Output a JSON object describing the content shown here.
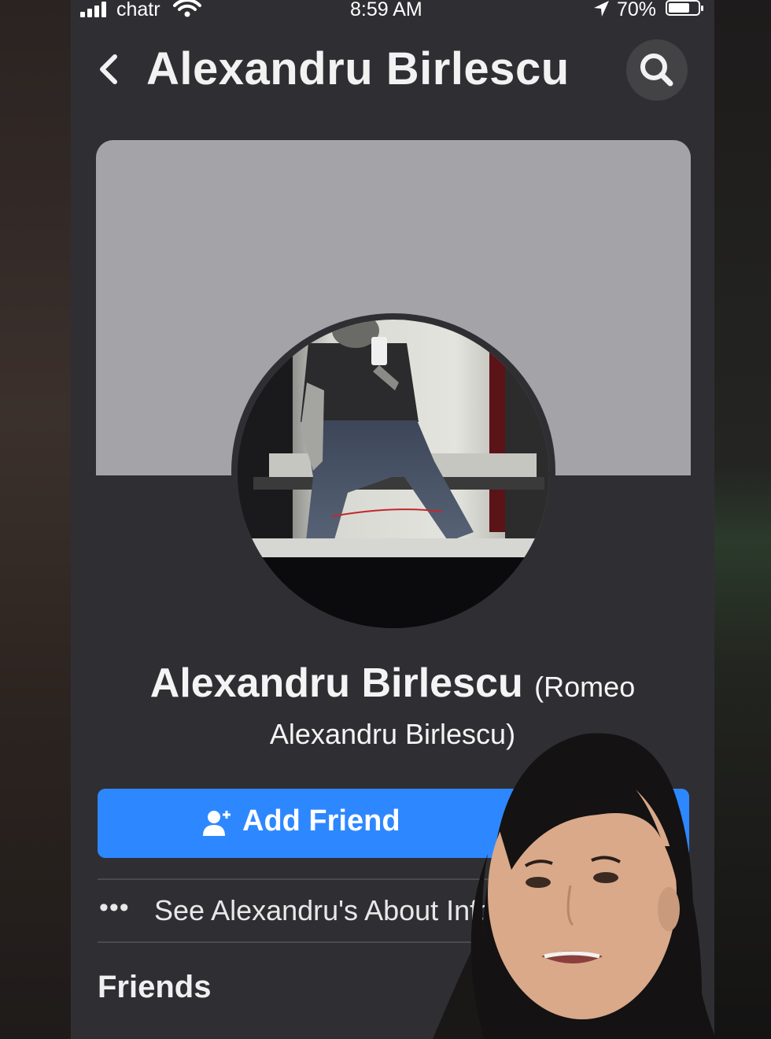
{
  "status_bar": {
    "carrier": "chatr",
    "time": "8:59 AM",
    "battery_percent": "70%",
    "battery_level": 0.7
  },
  "header": {
    "title": "Alexandru Birlescu",
    "back_icon": "chevron-left-icon",
    "search_icon": "search-icon"
  },
  "profile": {
    "name": "Alexandru Birlescu",
    "alternate_name_part1": "(Romeo",
    "alternate_name_part2": "Alexandru Birlescu)"
  },
  "actions": {
    "add_friend_label": "Add Friend",
    "add_friend_icon": "add-person-icon"
  },
  "about": {
    "more_icon": "•••",
    "label": "See Alexandru's About Info"
  },
  "sections": {
    "friends_title": "Friends"
  },
  "colors": {
    "background": "#2f2f33",
    "accent": "#2d88ff",
    "cover": "#a3a3a8"
  }
}
